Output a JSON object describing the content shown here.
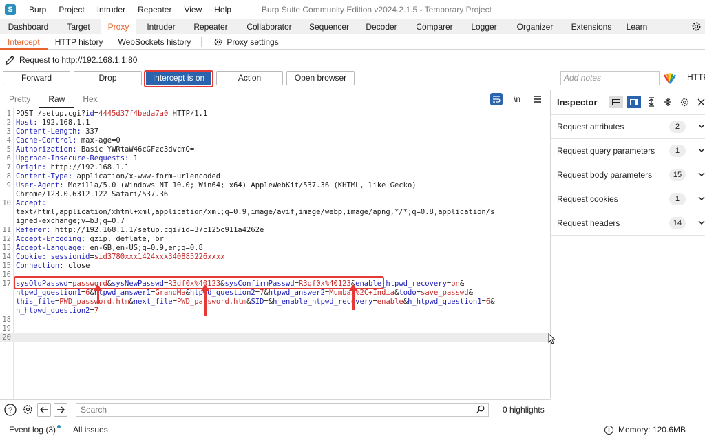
{
  "window": {
    "title": "Burp Suite Community Edition v2024.2.1.5 - Temporary Project",
    "app_icon": "S",
    "menu": [
      "Burp",
      "Project",
      "Intruder",
      "Repeater",
      "View",
      "Help"
    ]
  },
  "main_tabs": [
    "Dashboard",
    "Target",
    "Proxy",
    "Intruder",
    "Repeater",
    "Collaborator",
    "Sequencer",
    "Decoder",
    "Comparer",
    "Logger",
    "Organizer",
    "Extensions",
    "Learn"
  ],
  "main_tab_active": "Proxy",
  "sub_tabs": [
    "Intercept",
    "HTTP history",
    "WebSockets history"
  ],
  "sub_tab_active": "Intercept",
  "proxy_settings_label": "Proxy settings",
  "request_to": "Request to http://192.168.1.1:80",
  "buttons": {
    "forward": "Forward",
    "drop": "Drop",
    "intercept": "Intercept is on",
    "action": "Action",
    "open_browser": "Open browser"
  },
  "notes_placeholder": "Add notes",
  "http_label": "HTTP",
  "editor": {
    "tabs": [
      "Pretty",
      "Raw",
      "Hex"
    ],
    "active_tab": "Raw",
    "newline_toggle": "\\n",
    "lines": [
      {
        "n": "1",
        "parts": [
          {
            "t": "POST /setup.cgi?"
          },
          {
            "t": "id",
            "c": "k"
          },
          {
            "t": "="
          },
          {
            "t": "4445d37f4beda7a0",
            "c": "v"
          },
          {
            "t": " HTTP/1.1"
          }
        ]
      },
      {
        "n": "2",
        "parts": [
          {
            "t": "Host:",
            "c": "k"
          },
          {
            "t": " 192.168.1.1"
          }
        ]
      },
      {
        "n": "3",
        "parts": [
          {
            "t": "Content-Length:",
            "c": "k"
          },
          {
            "t": " 337"
          }
        ]
      },
      {
        "n": "4",
        "parts": [
          {
            "t": "Cache-Control:",
            "c": "k"
          },
          {
            "t": " max-age=0"
          }
        ]
      },
      {
        "n": "5",
        "parts": [
          {
            "t": "Authorization:",
            "c": "k"
          },
          {
            "t": " Basic YWRtaW46cGFzc3dvcmQ="
          }
        ]
      },
      {
        "n": "6",
        "parts": [
          {
            "t": "Upgrade-Insecure-Requests:",
            "c": "k"
          },
          {
            "t": " 1"
          }
        ]
      },
      {
        "n": "7",
        "parts": [
          {
            "t": "Origin:",
            "c": "k"
          },
          {
            "t": " http://192.168.1.1"
          }
        ]
      },
      {
        "n": "8",
        "parts": [
          {
            "t": "Content-Type:",
            "c": "k"
          },
          {
            "t": " application/x-www-form-urlencoded"
          }
        ]
      },
      {
        "n": "9",
        "parts": [
          {
            "t": "User-Agent:",
            "c": "k"
          },
          {
            "t": " Mozilla/5.0 (Windows NT 10.0; Win64; x64) AppleWebKit/537.36 (KHTML, like Gecko)"
          }
        ]
      },
      {
        "n": "",
        "parts": [
          {
            "t": "Chrome/123.0.6312.122 Safari/537.36"
          }
        ]
      },
      {
        "n": "10",
        "parts": [
          {
            "t": "Accept:",
            "c": "k"
          }
        ]
      },
      {
        "n": "",
        "parts": [
          {
            "t": "text/html,application/xhtml+xml,application/xml;q=0.9,image/avif,image/webp,image/apng,*/*;q=0.8,application/s"
          }
        ]
      },
      {
        "n": "",
        "parts": [
          {
            "t": "igned-exchange;v=b3;q=0.7"
          }
        ]
      },
      {
        "n": "11",
        "parts": [
          {
            "t": "Referer:",
            "c": "k"
          },
          {
            "t": " http://192.168.1.1/setup.cgi?id=37c125c911a4262e"
          }
        ]
      },
      {
        "n": "12",
        "parts": [
          {
            "t": "Accept-Encoding:",
            "c": "k"
          },
          {
            "t": " gzip, deflate, br"
          }
        ]
      },
      {
        "n": "13",
        "parts": [
          {
            "t": "Accept-Language:",
            "c": "k"
          },
          {
            "t": " en-GB,en-US;q=0.9,en;q=0.8"
          }
        ]
      },
      {
        "n": "14",
        "parts": [
          {
            "t": "Cookie:",
            "c": "k"
          },
          {
            "t": " "
          },
          {
            "t": "sessionid",
            "c": "k"
          },
          {
            "t": "="
          },
          {
            "t": "sid3780xxx1424xxx340885226xxxx",
            "c": "v"
          }
        ]
      },
      {
        "n": "15",
        "parts": [
          {
            "t": "Connection:",
            "c": "k"
          },
          {
            "t": " close"
          }
        ]
      },
      {
        "n": "16",
        "parts": []
      },
      {
        "n": "17",
        "parts": [
          {
            "t": "sysOldPasswd",
            "c": "k"
          },
          {
            "t": "="
          },
          {
            "t": "password",
            "c": "v"
          },
          {
            "t": "&"
          },
          {
            "t": "sysNewPasswd",
            "c": "k"
          },
          {
            "t": "="
          },
          {
            "t": "R3df0x%40123",
            "c": "v"
          },
          {
            "t": "&"
          },
          {
            "t": "sysConfirmPasswd",
            "c": "k"
          },
          {
            "t": "="
          },
          {
            "t": "R3df0x%40123",
            "c": "v"
          },
          {
            "t": "&"
          },
          {
            "t": "enable_htpwd_recovery",
            "c": "k"
          },
          {
            "t": "="
          },
          {
            "t": "on",
            "c": "v"
          },
          {
            "t": "&"
          }
        ]
      },
      {
        "n": "",
        "parts": [
          {
            "t": "htpwd_question1",
            "c": "k"
          },
          {
            "t": "="
          },
          {
            "t": "6",
            "c": "v"
          },
          {
            "t": "&"
          },
          {
            "t": "htpwd_answer1",
            "c": "k"
          },
          {
            "t": "="
          },
          {
            "t": "GrandMa",
            "c": "v"
          },
          {
            "t": "&"
          },
          {
            "t": "htpwd_question2",
            "c": "k"
          },
          {
            "t": "="
          },
          {
            "t": "7",
            "c": "v"
          },
          {
            "t": "&"
          },
          {
            "t": "htpwd_answer2",
            "c": "k"
          },
          {
            "t": "="
          },
          {
            "t": "Mumbai%2C+India",
            "c": "v"
          },
          {
            "t": "&"
          },
          {
            "t": "todo",
            "c": "k"
          },
          {
            "t": "="
          },
          {
            "t": "save_passwd",
            "c": "v"
          },
          {
            "t": "&"
          }
        ]
      },
      {
        "n": "",
        "parts": [
          {
            "t": "this_file",
            "c": "k"
          },
          {
            "t": "="
          },
          {
            "t": "PWD_password.htm",
            "c": "v"
          },
          {
            "t": "&"
          },
          {
            "t": "next_file",
            "c": "k"
          },
          {
            "t": "="
          },
          {
            "t": "PWD_password.htm",
            "c": "v"
          },
          {
            "t": "&"
          },
          {
            "t": "SID",
            "c": "k"
          },
          {
            "t": "=&"
          },
          {
            "t": "h_enable_htpwd_recovery",
            "c": "k"
          },
          {
            "t": "="
          },
          {
            "t": "enable",
            "c": "v"
          },
          {
            "t": "&"
          },
          {
            "t": "h_htpwd_question1",
            "c": "k"
          },
          {
            "t": "="
          },
          {
            "t": "6",
            "c": "v"
          },
          {
            "t": "&"
          }
        ]
      },
      {
        "n": "",
        "parts": [
          {
            "t": "h_htpwd_question2",
            "c": "k"
          },
          {
            "t": "="
          },
          {
            "t": "7",
            "c": "v"
          }
        ]
      },
      {
        "n": "18",
        "parts": []
      },
      {
        "n": "19",
        "parts": []
      },
      {
        "n": "20",
        "parts": [],
        "current": true
      }
    ]
  },
  "inspector": {
    "title": "Inspector",
    "sections": [
      {
        "label": "Request attributes",
        "count": "2"
      },
      {
        "label": "Request query parameters",
        "count": "1"
      },
      {
        "label": "Request body parameters",
        "count": "15"
      },
      {
        "label": "Request cookies",
        "count": "1"
      },
      {
        "label": "Request headers",
        "count": "14"
      }
    ]
  },
  "search": {
    "placeholder": "Search",
    "highlights": "0 highlights"
  },
  "status": {
    "event_log": "Event log (3)",
    "all_issues": "All issues",
    "memory": "Memory: 120.6MB"
  },
  "colors": {
    "accent": "#e8642c",
    "primary_button": "#2a64ad",
    "annotation_red": "#e53935",
    "key": "#1d1db5",
    "value": "#c62828"
  }
}
